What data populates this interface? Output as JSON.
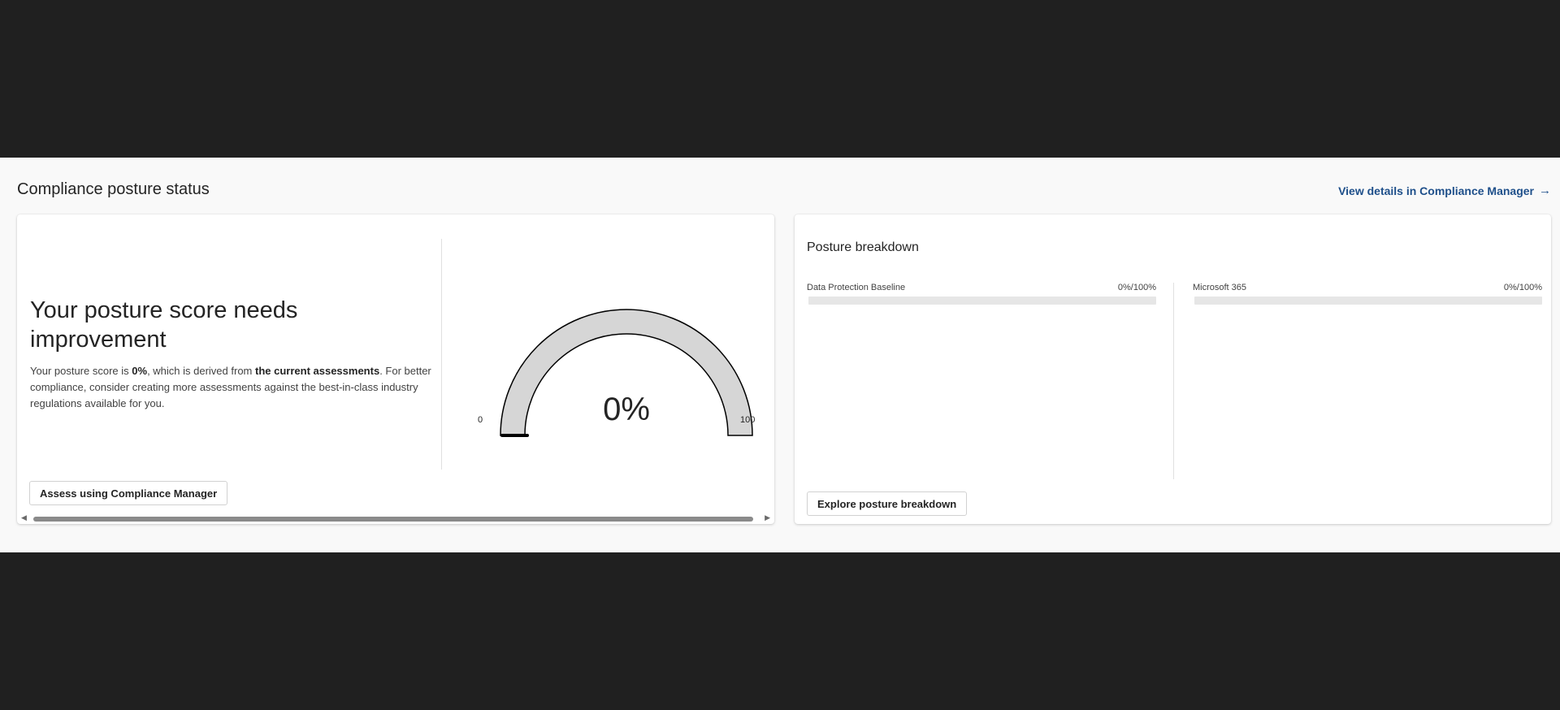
{
  "section": {
    "title": "Compliance posture status",
    "view_link": "View details in Compliance Manager",
    "view_link_icon": "arrow-right-icon"
  },
  "score_card": {
    "heading": "Your posture score needs improvement",
    "desc_prefix": "Your posture score is ",
    "desc_score": "0%",
    "desc_middle": ", which is derived from ",
    "desc_bold": "the current assessments",
    "desc_suffix": ". For better compliance, consider creating more assessments against the best-in-class industry regulations available for you.",
    "assess_button": "Assess using Compliance Manager"
  },
  "gauge": {
    "value_label": "0%",
    "value": 0,
    "min_label": "0",
    "max_label": "100",
    "track_color": "#d6d6d6"
  },
  "breakdown": {
    "title": "Posture breakdown",
    "items": [
      {
        "name": "Data Protection Baseline",
        "value_label": "0%/100%",
        "progress": 0
      },
      {
        "name": "Microsoft 365",
        "value_label": "0%/100%",
        "progress": 0
      }
    ],
    "explore_button": "Explore posture breakdown"
  }
}
